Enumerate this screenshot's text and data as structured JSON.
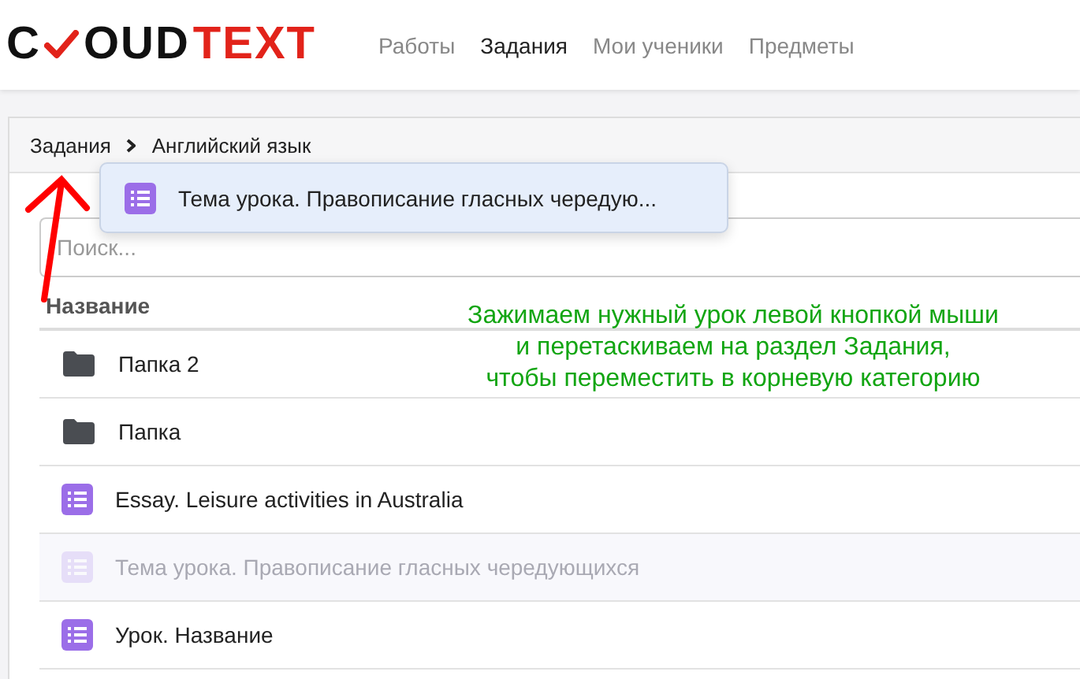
{
  "logo": {
    "before_check": "C",
    "after_check": "OUD",
    "accent": "TEXT"
  },
  "nav": [
    {
      "label": "Работы",
      "selected": false
    },
    {
      "label": "Задания",
      "selected": true
    },
    {
      "label": "Мои ученики",
      "selected": false
    },
    {
      "label": "Предметы",
      "selected": false
    }
  ],
  "breadcrumbs": [
    "Задания",
    "Английский язык"
  ],
  "drag_preview": {
    "label": "Тема урока. Правописание гласных чередую..."
  },
  "search": {
    "placeholder": "Поиск..."
  },
  "table": {
    "header": "Название",
    "rows": [
      {
        "kind": "folder",
        "name": "Папка 2",
        "dragging": false
      },
      {
        "kind": "folder",
        "name": "Папка",
        "dragging": false
      },
      {
        "kind": "lesson",
        "name": "Essay. Leisure activities in Australia",
        "dragging": false
      },
      {
        "kind": "lesson",
        "name": "Тема урока. Правописание гласных чередующихся",
        "dragging": true
      },
      {
        "kind": "lesson",
        "name": "Урок. Название",
        "dragging": false
      }
    ]
  },
  "annotation": [
    "Зажимаем нужный урок левой кнопкой мыши",
    "и перетаскиваем на раздел Задания,",
    "чтобы переместить в корневую категорию"
  ]
}
